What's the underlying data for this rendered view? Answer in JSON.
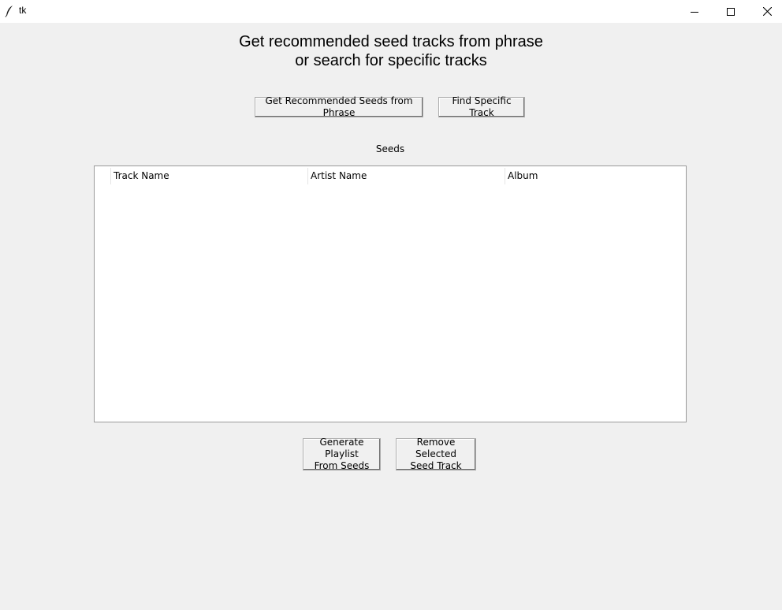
{
  "window": {
    "title": "tk",
    "icons": {
      "app": "feather-icon",
      "minimize": "minimize-icon",
      "maximize": "maximize-icon",
      "close": "close-icon"
    }
  },
  "heading": {
    "line1": "Get recommended seed tracks from phrase",
    "line2": "or search for specific tracks"
  },
  "top_buttons": {
    "recommend_label": "Get Recommended Seeds from Phrase",
    "find_label": "Find Specific Track"
  },
  "seeds": {
    "label": "Seeds",
    "columns": [
      "Track Name",
      "Artist Name",
      "Album"
    ],
    "rows": []
  },
  "bottom_buttons": {
    "generate_label": "Generate Playlist\nFrom Seeds",
    "remove_label": "Remove Selected\nSeed Track"
  }
}
